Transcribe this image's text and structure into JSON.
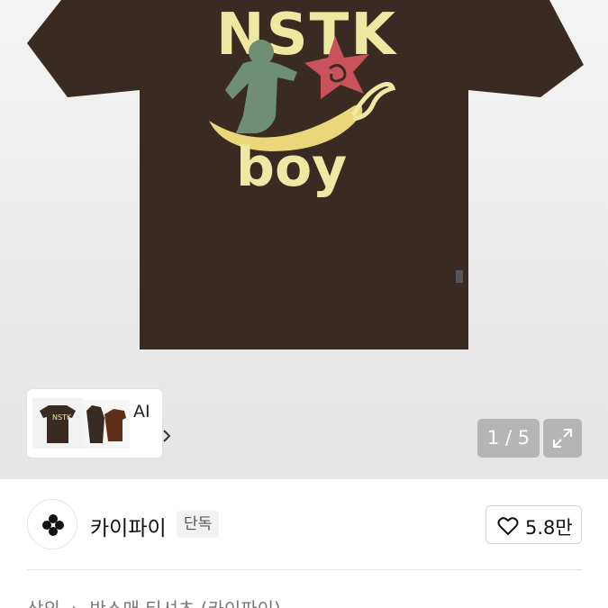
{
  "gallery": {
    "print_text_top": "NSTK",
    "print_text_bottom": "boy",
    "thumb_ai_label": "AI",
    "counter": "1 / 5",
    "colors": {
      "shirt": "#3a2b22",
      "print_cream": "#efe8a2",
      "figure": "#6f8f74",
      "star": "#c9525c",
      "banana": "#e9d77a"
    }
  },
  "seller": {
    "name": "카이파이",
    "badge": "단독",
    "likes": "5.8만"
  },
  "breadcrumb": {
    "category": "상의",
    "separator": "›",
    "subcategory": "반소매 티셔츠 (카이파이)"
  }
}
